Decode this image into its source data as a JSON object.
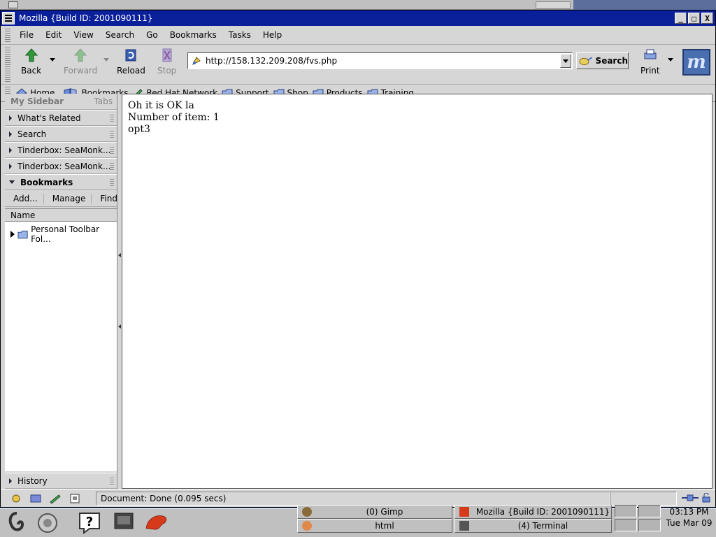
{
  "window": {
    "title": "Mozilla {Build ID: 2001090111}",
    "minimize": "_",
    "maximize": "□",
    "close": "X"
  },
  "menu": [
    "File",
    "Edit",
    "View",
    "Search",
    "Go",
    "Bookmarks",
    "Tasks",
    "Help"
  ],
  "nav": {
    "back": "Back",
    "forward": "Forward",
    "reload": "Reload",
    "stop": "Stop",
    "url": "http://158.132.209.208/fvs.php",
    "search": "Search",
    "print": "Print",
    "throbber": "m"
  },
  "personal_toolbar": [
    "Home",
    "Bookmarks",
    "Red Hat Network",
    "Support",
    "Shop",
    "Products",
    "Training"
  ],
  "sidebar": {
    "title": "My Sidebar",
    "tabs": "Tabs",
    "panels": [
      "What's Related",
      "Search",
      "Tinderbox: SeaMonk...",
      "Tinderbox: SeaMonk..."
    ],
    "bookmarks_panel": "Bookmarks",
    "bookmark_tools": [
      "Add...",
      "Manage",
      "Find..."
    ],
    "column": "Name",
    "tree_item": "Personal Toolbar Fol...",
    "history": "History"
  },
  "content": {
    "lines": [
      "Oh it is OK la",
      "Number of item: 1",
      "opt3"
    ]
  },
  "status": {
    "message": "Document: Done (0.095 secs)"
  },
  "taskbar": {
    "tasks": [
      "(0) Gimp",
      "Mozilla {Build ID: 2001090111}",
      "html",
      "(4) Terminal"
    ],
    "clock_time": "03:13 PM",
    "clock_date": "Tue Mar 09"
  },
  "colors": {
    "titlebar": "#0a1f9a",
    "chrome": "#d6d6d6",
    "desktop": "#5a6f9c"
  }
}
